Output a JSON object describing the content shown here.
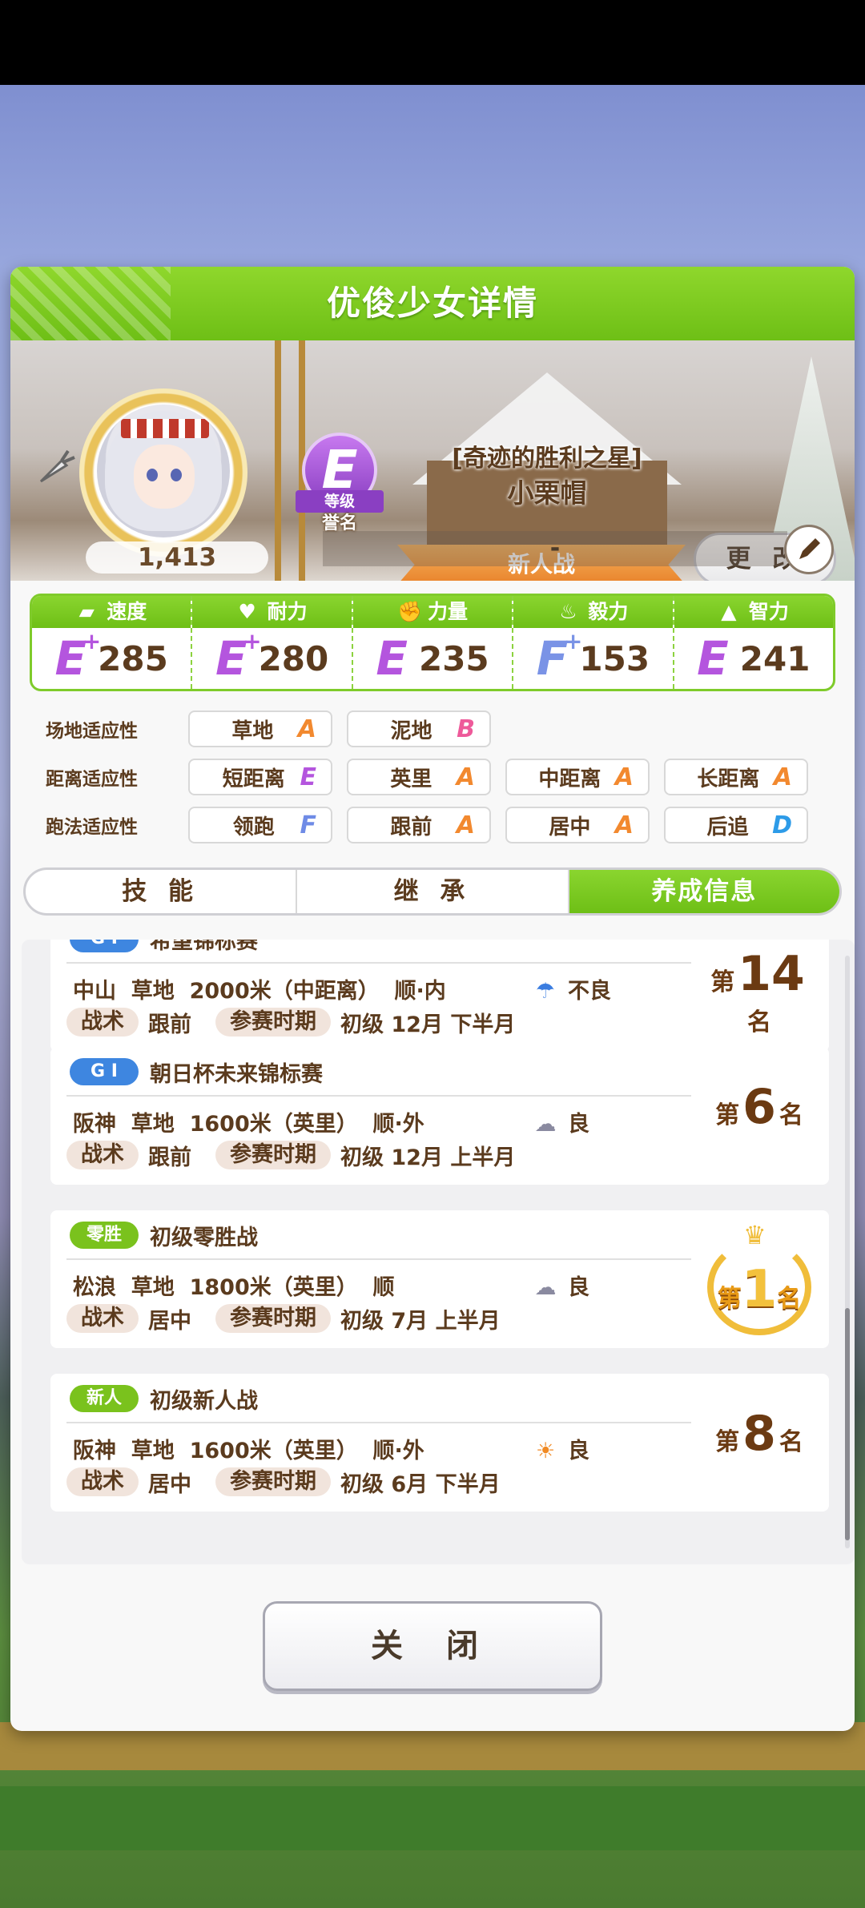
{
  "dialog": {
    "title": "优俊少女详情"
  },
  "character": {
    "fans": "1,413",
    "grade": "E",
    "grade_label": "等级",
    "grade_sub": "誉名",
    "title": "[奇迹的胜利之星]",
    "name": "小栗帽",
    "race_ribbon": "新人战",
    "memo": "-",
    "change_label": "更 改"
  },
  "stats": [
    {
      "label": "速度",
      "icon": "shoe-icon",
      "grade": "E",
      "plus": true,
      "value": "285"
    },
    {
      "label": "耐力",
      "icon": "heart-icon",
      "grade": "E",
      "plus": true,
      "value": "280"
    },
    {
      "label": "力量",
      "icon": "muscle-icon",
      "grade": "E",
      "plus": false,
      "value": "235"
    },
    {
      "label": "毅力",
      "icon": "flame-icon",
      "grade": "F",
      "plus": true,
      "value": "153"
    },
    {
      "label": "智力",
      "icon": "graduation-cap-icon",
      "grade": "E",
      "plus": false,
      "value": "241"
    }
  ],
  "aptitude": {
    "track": {
      "label": "场地适应性",
      "items": [
        {
          "name": "草地",
          "rank": "A"
        },
        {
          "name": "泥地",
          "rank": "B"
        }
      ]
    },
    "distance": {
      "label": "距离适应性",
      "items": [
        {
          "name": "短距离",
          "rank": "E"
        },
        {
          "name": "英里",
          "rank": "A"
        },
        {
          "name": "中距离",
          "rank": "A"
        },
        {
          "name": "长距离",
          "rank": "A"
        }
      ]
    },
    "style": {
      "label": "跑法适应性",
      "items": [
        {
          "name": "领跑",
          "rank": "F"
        },
        {
          "name": "跟前",
          "rank": "A"
        },
        {
          "name": "居中",
          "rank": "A"
        },
        {
          "name": "后追",
          "rank": "D"
        }
      ]
    }
  },
  "tabs": [
    {
      "label": "技 能"
    },
    {
      "label": "继 承"
    },
    {
      "label": "养成信息",
      "active": true
    }
  ],
  "races": [
    {
      "tag": "G I",
      "name": "希望锦标赛",
      "info": "中山  草地  2000米（中距离）  顺·内",
      "weather_icon": "umbrella-icon",
      "weather": "不良",
      "tactic_label": "战术",
      "tactic": "跟前",
      "period_label": "参赛时期",
      "period": "初级  12月  下半月",
      "place_pre": "第",
      "place": "14",
      "place_post": "名"
    },
    {
      "tag": "G I",
      "name": "朝日杯未来锦标赛",
      "info": "阪神  草地  1600米（英里）  顺·外",
      "weather_icon": "cloud-icon",
      "weather": "良",
      "tactic_label": "战术",
      "tactic": "跟前",
      "period_label": "参赛时期",
      "period": "初级  12月  上半月",
      "place_pre": "第",
      "place": "6",
      "place_post": "名"
    },
    {
      "tag": "零胜",
      "name": "初级零胜战",
      "info": "松浪  草地  1800米（英里）  顺",
      "weather_icon": "cloud-icon",
      "weather": "良",
      "tactic_label": "战术",
      "tactic": "居中",
      "period_label": "参赛时期",
      "period": "初级  7月  上半月",
      "place_pre": "第",
      "place": "1",
      "place_post": "名"
    },
    {
      "tag": "新人",
      "name": "初级新人战",
      "info": "阪神  草地  1600米（英里）  顺·外",
      "weather_icon": "sun-icon",
      "weather": "良",
      "tactic_label": "战术",
      "tactic": "居中",
      "period_label": "参赛时期",
      "period": "初级  6月  下半月",
      "place_pre": "第",
      "place": "8",
      "place_post": "名"
    }
  ],
  "close_label": "关 闭"
}
